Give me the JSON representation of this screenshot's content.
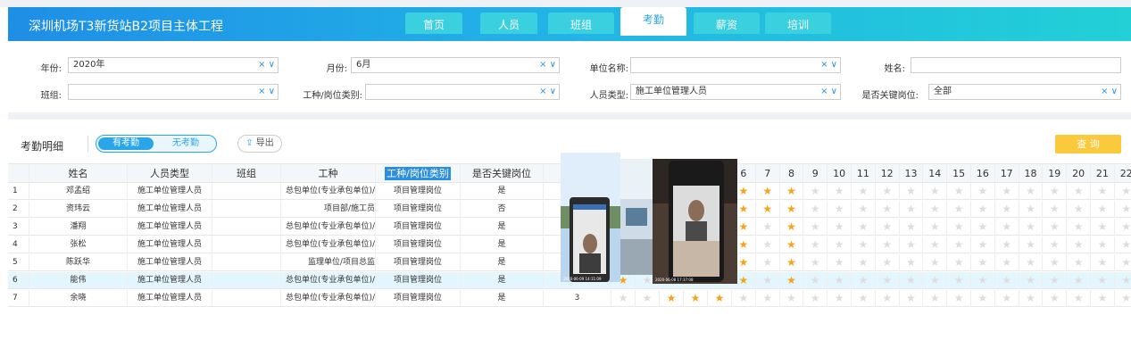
{
  "app": {
    "title": "深圳机场T3新货站B2项目主体工程"
  },
  "tabs": [
    {
      "label": "首页",
      "active": false
    },
    {
      "label": "人员",
      "active": false
    },
    {
      "label": "班组",
      "active": false
    },
    {
      "label": "考勤",
      "active": true
    },
    {
      "label": "薪资",
      "active": false
    },
    {
      "label": "培训",
      "active": false
    }
  ],
  "filters": {
    "year": {
      "label": "年份:",
      "value": "2020年"
    },
    "month": {
      "label": "月份:",
      "value": "6月"
    },
    "unit": {
      "label": "单位名称:",
      "value": ""
    },
    "name": {
      "label": "姓名:",
      "value": ""
    },
    "team": {
      "label": "班组:",
      "value": ""
    },
    "work_type": {
      "label": "工种/岗位类别:",
      "value": ""
    },
    "person_type": {
      "label": "人员类型:",
      "value": "施工单位管理人员"
    },
    "key_post": {
      "label": "是否关键岗位:",
      "value": "全部"
    },
    "clear_symbol": "×",
    "dropdown_symbol": "∨"
  },
  "toolbar": {
    "section_label": "考勤明细",
    "toggle_on": "有考勤",
    "toggle_off": "无考勤",
    "export_label": "导出",
    "query_label": "查 询"
  },
  "table": {
    "columns": [
      "姓名",
      "人员类型",
      "班组",
      "工种",
      "工种/岗位类别",
      "是否关键岗位",
      "出"
    ],
    "day_columns": [
      "6",
      "7",
      "8",
      "9",
      "10",
      "11",
      "12",
      "13",
      "14",
      "15",
      "16",
      "17",
      "18",
      "19",
      "20",
      "21",
      "22"
    ],
    "rows": [
      {
        "idx": "1",
        "name": "邓孟绍",
        "type": "施工单位管理人员",
        "team": "",
        "work": "总包单位(专业承包单位)/",
        "category": "项目管理岗位",
        "key": "是",
        "count": "",
        "stars": [
          1,
          1,
          1,
          0,
          0,
          0,
          0,
          0,
          0,
          0,
          0,
          0,
          0,
          0,
          0,
          0,
          0
        ]
      },
      {
        "idx": "2",
        "name": "资玮云",
        "type": "施工单位管理人员",
        "team": "",
        "work": "项目部/施工员",
        "category": "项目管理岗位",
        "key": "否",
        "count": "",
        "stars": [
          1,
          1,
          1,
          0,
          0,
          0,
          0,
          0,
          0,
          0,
          0,
          0,
          0,
          0,
          0,
          0,
          0
        ]
      },
      {
        "idx": "3",
        "name": "潘翔",
        "type": "施工单位管理人员",
        "team": "",
        "work": "总包单位(专业承包单位)/",
        "category": "项目管理岗位",
        "key": "是",
        "count": "",
        "stars": [
          1,
          0,
          1,
          0,
          0,
          0,
          0,
          0,
          0,
          0,
          0,
          0,
          0,
          0,
          0,
          0,
          0
        ]
      },
      {
        "idx": "4",
        "name": "张松",
        "type": "施工单位管理人员",
        "team": "",
        "work": "总包单位(专业承包单位)/",
        "category": "项目管理岗位",
        "key": "是",
        "count": "",
        "stars": [
          1,
          0,
          1,
          0,
          0,
          0,
          0,
          0,
          0,
          0,
          0,
          0,
          0,
          0,
          0,
          0,
          0
        ]
      },
      {
        "idx": "5",
        "name": "陈跃华",
        "type": "施工单位管理人员",
        "team": "",
        "work": "监理单位/项目总监",
        "category": "项目管理岗位",
        "key": "是",
        "count": "",
        "stars": [
          1,
          0,
          1,
          0,
          0,
          0,
          0,
          0,
          0,
          0,
          0,
          0,
          0,
          0,
          0,
          0,
          0
        ]
      },
      {
        "idx": "6",
        "name": "能伟",
        "type": "施工单位管理人员",
        "team": "",
        "work": "总包单位(专业承包单位)/",
        "category": "项目管理岗位",
        "key": "是",
        "count": "4",
        "stars": [
          1,
          0,
          1,
          0,
          0,
          0,
          0,
          0,
          0,
          0,
          0,
          0,
          0,
          0,
          0,
          0,
          0
        ]
      },
      {
        "idx": "7",
        "name": "余晓",
        "type": "施工单位管理人员",
        "team": "",
        "work": "总包单位(专业承包单位)/",
        "category": "项目管理岗位",
        "key": "是",
        "count": "3",
        "stars": [
          0,
          0,
          0,
          0,
          0,
          0,
          0,
          0,
          0,
          0,
          0,
          0,
          0,
          0,
          0,
          0,
          0
        ]
      }
    ],
    "extra_stars_row7": [
      0,
      0,
      1,
      1,
      1
    ],
    "extra_stars_row6": [
      1,
      0,
      0
    ]
  },
  "photos": {
    "left_timestamp": "2020-06-09 14:11:09",
    "right_timestamp": "2020-06-08 17:37:08"
  },
  "colors": {
    "accent": "#2aa6e8",
    "star": "#f7a21b",
    "query": "#fbc93c"
  }
}
